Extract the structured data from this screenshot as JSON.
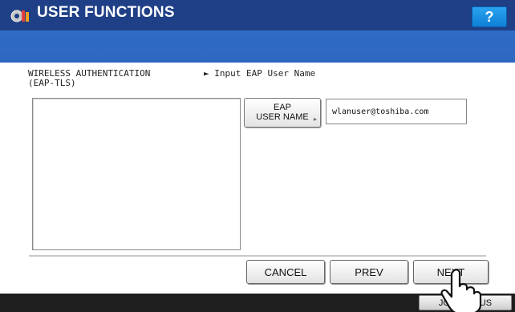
{
  "header": {
    "title": "USER FUNCTIONS",
    "help_label": "?",
    "logo_icon": "user-functions-gear-icon"
  },
  "section": {
    "auth_line1": "WIRELESS AUTHENTICATION",
    "auth_line2": "(EAP-TLS)",
    "step_label": "► Input EAP User Name"
  },
  "field": {
    "button_line1": "EAP",
    "button_line2": "USER NAME",
    "value": "wlanuser@toshiba.com"
  },
  "buttons": {
    "cancel": "CANCEL",
    "prev": "PREV",
    "next": "NEXT"
  },
  "footer": {
    "job_status": "JOB STATUS"
  },
  "colors": {
    "title_bar": "#1f3f86",
    "sub_bar": "#2f6cc6",
    "help_button": "#1a90e0",
    "bottom_bar": "#1e1e1e"
  }
}
